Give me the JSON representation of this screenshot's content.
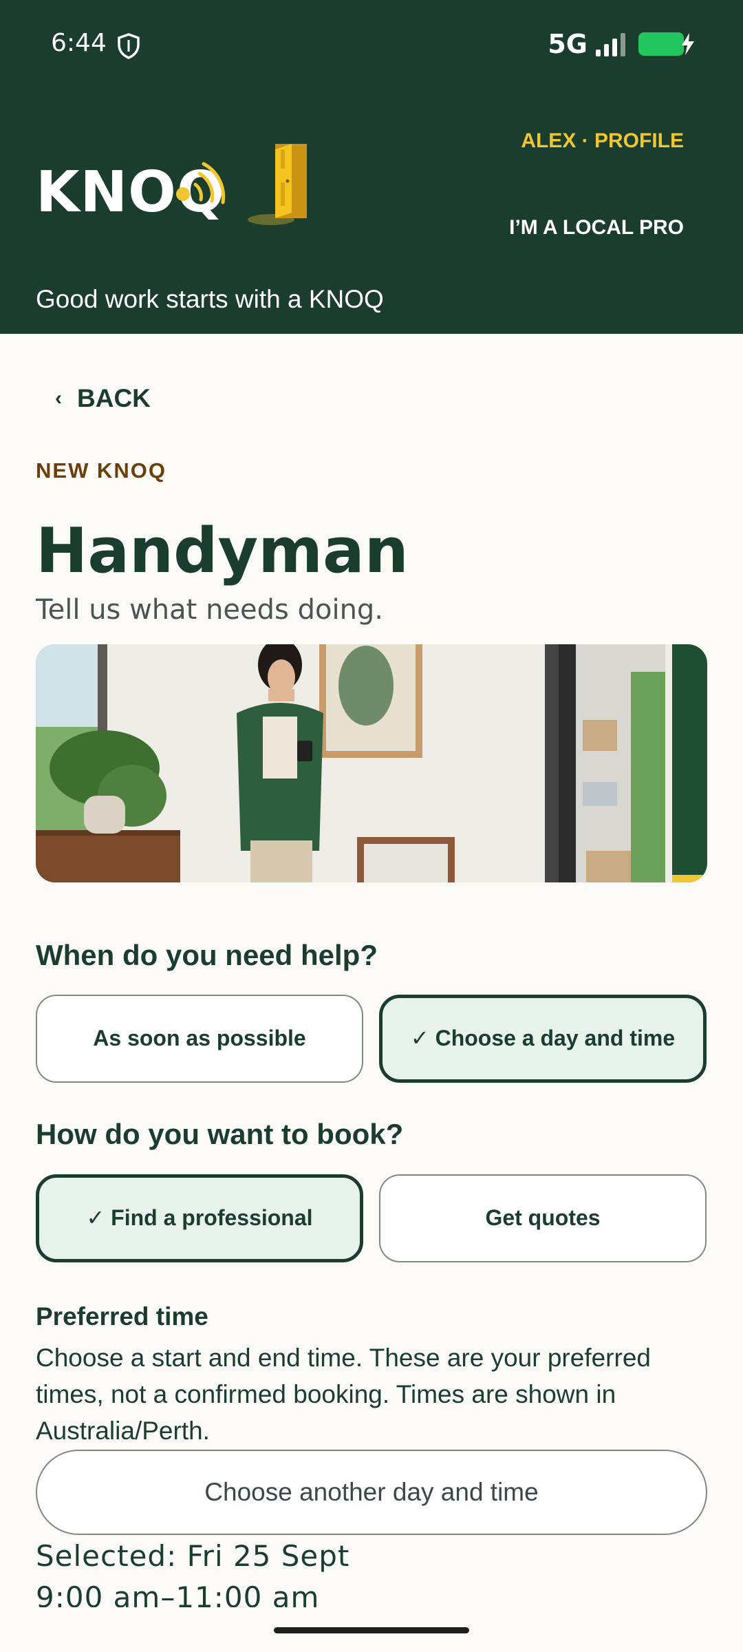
{
  "status": {
    "time": "6:44",
    "network": "5G"
  },
  "header": {
    "logo_text": "KNOQ",
    "profile_link": "ALEX · PROFILE",
    "pro_link": "I’M A LOCAL PRO",
    "tagline": "Good work starts with a KNOQ"
  },
  "nav": {
    "back_label": "BACK"
  },
  "page": {
    "eyebrow": "NEW KNOQ",
    "title": "Handyman",
    "subtitle": "Tell us what needs doing."
  },
  "when": {
    "question": "When do you need help?",
    "options": [
      {
        "label": "As soon as possible",
        "selected": false
      },
      {
        "label": "✓ Choose a day and time",
        "selected": true
      }
    ]
  },
  "how": {
    "question": "How do you want to book?",
    "options": [
      {
        "label": "✓ Find a professional",
        "selected": true
      },
      {
        "label": "Get quotes",
        "selected": false
      }
    ]
  },
  "preferred": {
    "title": "Preferred time",
    "description": "Choose a start and end time. These are your preferred times, not a confirmed booking. Times are shown in Australia/Perth.",
    "button_label": "Choose another day and time",
    "selected_label": "Selected: Fri 25 Sept",
    "time_range": "9:00 am–11:00 am"
  },
  "colors": {
    "header_bg": "#1b3d2d",
    "accent_yellow": "#f1c631",
    "selected_bg": "#e8f2ec",
    "battery": "#22c55e"
  }
}
